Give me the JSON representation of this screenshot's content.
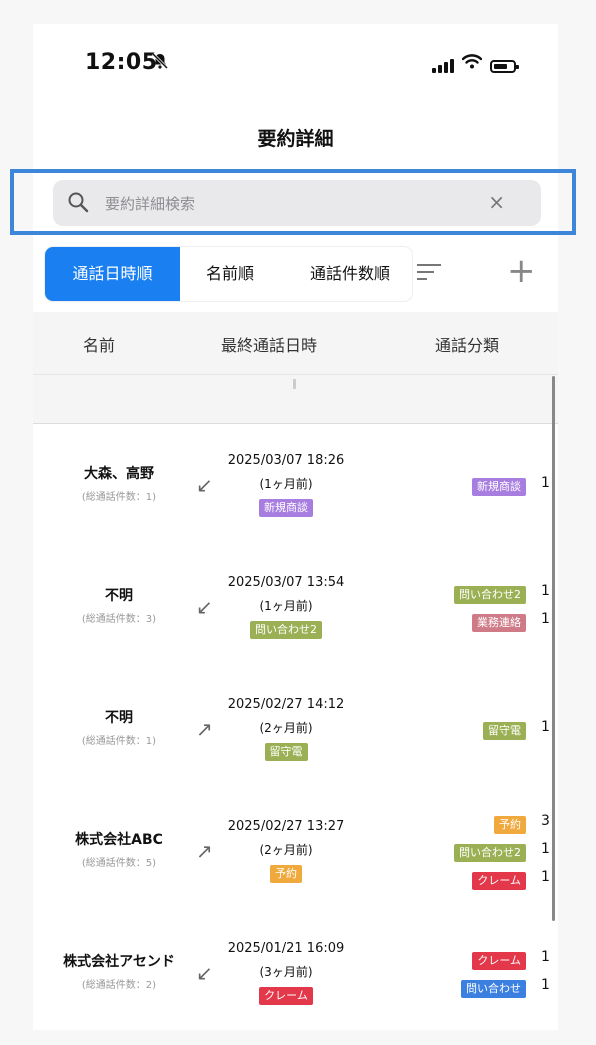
{
  "status": {
    "time": "12:05",
    "bell_icon": "bell-slash-icon",
    "wifi_icon": "wifi-icon",
    "battery_icon": "battery-icon"
  },
  "title": "要約詳細",
  "search": {
    "placeholder": "要約詳細検索",
    "clear": "×"
  },
  "sort": {
    "tabs": [
      "通話日時順",
      "名前順",
      "通話件数順"
    ],
    "active_index": 0,
    "filter_icon": "sort-lines-icon",
    "add_icon": "plus-icon",
    "add": "+"
  },
  "columns": {
    "name": "名前",
    "last_call": "最終通話日時",
    "category": "通話分類"
  },
  "colors": {
    "accent": "#1a7ff0",
    "shinki": "#a77ee0",
    "toiawase2": "#9bb055",
    "gyomu": "#cf7b87",
    "rusuden": "#9bb055",
    "yoyaku": "#f0a93c",
    "claim": "#e3374a",
    "toiawase": "#3b7fe0",
    "highlight": "#3d86d9"
  },
  "rows": [
    {
      "name": "大森、高野",
      "count": "(総通話件数：1)",
      "direction": "incoming",
      "dir_glyph": "↙",
      "datetime": "2025/03/07 18:26",
      "ago": "(1ヶ月前)",
      "tag": "新規商談",
      "tag_color": "#a77ee0",
      "categories": [
        {
          "label": "新規商談",
          "color": "#a77ee0",
          "num": "1"
        }
      ]
    },
    {
      "name": "不明",
      "count": "(総通話件数：3)",
      "direction": "incoming",
      "dir_glyph": "↙",
      "datetime": "2025/03/07 13:54",
      "ago": "(1ヶ月前)",
      "tag": "問い合わせ2",
      "tag_color": "#9bb055",
      "categories": [
        {
          "label": "問い合わせ2",
          "color": "#9bb055",
          "num": "1"
        },
        {
          "label": "業務連絡",
          "color": "#cf7b87",
          "num": "1"
        }
      ]
    },
    {
      "name": "不明",
      "count": "(総通話件数：1)",
      "direction": "outgoing",
      "dir_glyph": "↗",
      "datetime": "2025/02/27 14:12",
      "ago": "(2ヶ月前)",
      "tag": "留守電",
      "tag_color": "#9bb055",
      "categories": [
        {
          "label": "留守電",
          "color": "#9bb055",
          "num": "1"
        }
      ]
    },
    {
      "name": "株式会社ABC",
      "count": "(総通話件数：5)",
      "direction": "outgoing",
      "dir_glyph": "↗",
      "datetime": "2025/02/27 13:27",
      "ago": "(2ヶ月前)",
      "tag": "予約",
      "tag_color": "#f0a93c",
      "categories": [
        {
          "label": "予約",
          "color": "#f0a93c",
          "num": "3"
        },
        {
          "label": "問い合わせ2",
          "color": "#9bb055",
          "num": "1"
        },
        {
          "label": "クレーム",
          "color": "#e3374a",
          "num": "1"
        }
      ]
    },
    {
      "name": "株式会社アセンド",
      "count": "(総通話件数：2)",
      "direction": "incoming",
      "dir_glyph": "↙",
      "datetime": "2025/01/21 16:09",
      "ago": "(3ヶ月前)",
      "tag": "クレーム",
      "tag_color": "#e3374a",
      "categories": [
        {
          "label": "クレーム",
          "color": "#e3374a",
          "num": "1"
        },
        {
          "label": "問い合わせ",
          "color": "#3b7fe0",
          "num": "1"
        }
      ]
    }
  ]
}
